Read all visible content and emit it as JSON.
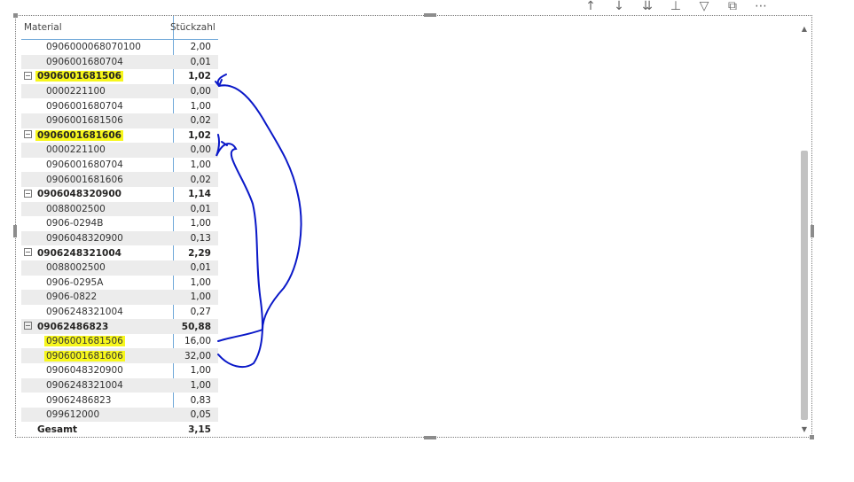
{
  "table": {
    "headers": {
      "material": "Material",
      "count": "Stückzahl"
    },
    "rows": [
      {
        "type": "child",
        "material": "0906000068070100",
        "value": "2,00",
        "highlight": false
      },
      {
        "type": "child",
        "material": "0906001680704",
        "value": "0,01",
        "highlight": false
      },
      {
        "type": "group",
        "material": "0906001681506",
        "value": "1,02",
        "highlight": true
      },
      {
        "type": "child",
        "material": "0000221100",
        "value": "0,00",
        "highlight": false
      },
      {
        "type": "child",
        "material": "0906001680704",
        "value": "1,00",
        "highlight": false
      },
      {
        "type": "child",
        "material": "0906001681506",
        "value": "0,02",
        "highlight": false
      },
      {
        "type": "group",
        "material": "0906001681606",
        "value": "1,02",
        "highlight": true
      },
      {
        "type": "child",
        "material": "0000221100",
        "value": "0,00",
        "highlight": false
      },
      {
        "type": "child",
        "material": "0906001680704",
        "value": "1,00",
        "highlight": false
      },
      {
        "type": "child",
        "material": "0906001681606",
        "value": "0,02",
        "highlight": false
      },
      {
        "type": "group",
        "material": "0906048320900",
        "value": "1,14",
        "highlight": false
      },
      {
        "type": "child",
        "material": "0088002500",
        "value": "0,01",
        "highlight": false
      },
      {
        "type": "child",
        "material": "0906-0294B",
        "value": "1,00",
        "highlight": false
      },
      {
        "type": "child",
        "material": "0906048320900",
        "value": "0,13",
        "highlight": false
      },
      {
        "type": "group",
        "material": "0906248321004",
        "value": "2,29",
        "highlight": false
      },
      {
        "type": "child",
        "material": "0088002500",
        "value": "0,01",
        "highlight": false
      },
      {
        "type": "child",
        "material": "0906-0295A",
        "value": "1,00",
        "highlight": false
      },
      {
        "type": "child",
        "material": "0906-0822",
        "value": "1,00",
        "highlight": false
      },
      {
        "type": "child",
        "material": "0906248321004",
        "value": "0,27",
        "highlight": false
      },
      {
        "type": "group",
        "material": "09062486823",
        "value": "50,88",
        "highlight": false
      },
      {
        "type": "child",
        "material": "0906001681506",
        "value": "16,00",
        "highlight": true
      },
      {
        "type": "child",
        "material": "0906001681606",
        "value": "32,00",
        "highlight": true
      },
      {
        "type": "child",
        "material": "0906048320900",
        "value": "1,00",
        "highlight": false
      },
      {
        "type": "child",
        "material": "0906248321004",
        "value": "1,00",
        "highlight": false
      },
      {
        "type": "child",
        "material": "09062486823",
        "value": "0,83",
        "highlight": false
      },
      {
        "type": "child",
        "material": "099612000",
        "value": "0,05",
        "highlight": false
      }
    ],
    "total": {
      "label": "Gesamt",
      "value": "3,15"
    }
  },
  "header_icons": [
    "arrow-up-icon",
    "arrow-down-icon",
    "double-arrow-down-icon",
    "expand-hierarchy-icon",
    "filter-icon",
    "focus-mode-icon",
    "more-options-icon"
  ],
  "colors": {
    "highlight": "#f7f71c",
    "annotation": "#0a18c8",
    "divider": "#6ea7d8"
  }
}
